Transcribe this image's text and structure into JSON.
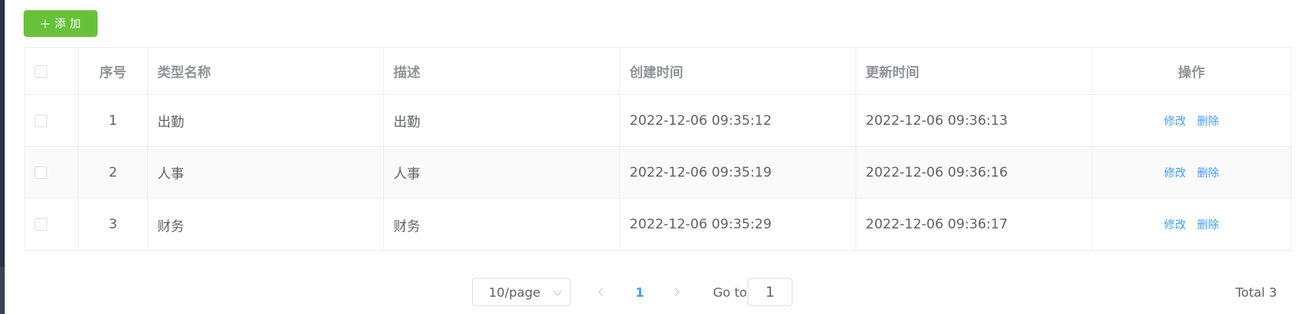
{
  "toolbar": {
    "add_label": "添加",
    "add_color": "#67c23a"
  },
  "table": {
    "columns": [
      "序号",
      "类型名称",
      "描述",
      "创建时间",
      "更新时间",
      "操作"
    ],
    "rows": [
      {
        "index": "1",
        "name": "出勤",
        "desc": "出勤",
        "created": "2022-12-06 09:35:12",
        "updated": "2022-12-06 09:36:13"
      },
      {
        "index": "2",
        "name": "人事",
        "desc": "人事",
        "created": "2022-12-06 09:35:19",
        "updated": "2022-12-06 09:36:16"
      },
      {
        "index": "3",
        "name": "财务",
        "desc": "财务",
        "created": "2022-12-06 09:35:29",
        "updated": "2022-12-06 09:36:17"
      }
    ],
    "actions": {
      "edit": "修改",
      "delete": "删除"
    },
    "link_color": "#409eff"
  },
  "pagination": {
    "page_size": "10/page",
    "current_page": "1",
    "goto_label": "Go to",
    "goto_value": "1",
    "total": "Total 3"
  }
}
